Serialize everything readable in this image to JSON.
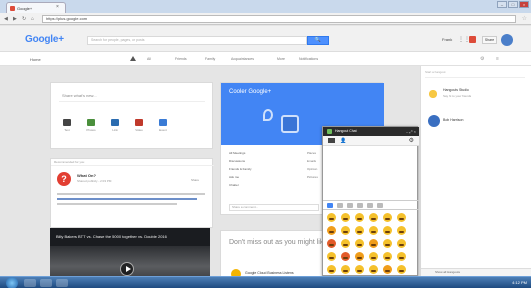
{
  "browser": {
    "tab_title": "Google+",
    "tab_close": "×",
    "url": "https://plus.google.com",
    "nav_back": "◀",
    "nav_forward": "▶",
    "nav_reload": "↻",
    "nav_home": "⌂",
    "star": "☆",
    "window_controls": [
      "–",
      "□",
      "×"
    ]
  },
  "header": {
    "logo": "Google+",
    "search_placeholder": "Search for people, pages, or posts",
    "search_button": "🔍",
    "user_name": "Frank",
    "share_label": "Share"
  },
  "subnav": {
    "home_label": "Home",
    "filters": [
      "All",
      "Friends",
      "Family",
      "Acquaintances",
      "More",
      "Notifications"
    ]
  },
  "share_box": {
    "prompt": "Share what's new...",
    "actions": [
      {
        "label": "Text",
        "color": "#444"
      },
      {
        "label": "Photos",
        "color": "#4a8f3c"
      },
      {
        "label": "Link",
        "color": "#2b6cb0"
      },
      {
        "label": "Video",
        "color": "#c0392b"
      },
      {
        "label": "Event",
        "color": "#3a7bd5"
      }
    ]
  },
  "post": {
    "header": "Recommended for you",
    "author": "What On?",
    "meta": "Shared publicly - 2:03 PM",
    "share_label": "Share",
    "avatar_letter": "?"
  },
  "video": {
    "title": "Billy Bakers BTT vs. Chase the 5000 together vs. Double 2016"
  },
  "community": {
    "title": "Cooler Google+",
    "rows": [
      {
        "left": "All Meetings",
        "right": "Places"
      },
      {
        "left": "Discussions",
        "right": "Emails"
      },
      {
        "left": "Friends & Family",
        "right": "Opinion"
      },
      {
        "left": "Ask me",
        "right": "Pictures"
      },
      {
        "left": "Chatter",
        "right": ""
      }
    ],
    "input_placeholder": "Share a comment..."
  },
  "know": {
    "title": "Don't miss out as you might like",
    "item": "Google Cloud Business Listens"
  },
  "sidebar": {
    "search_placeholder": "Start a hangout",
    "contacts": [
      {
        "name": "Hangouts Studio",
        "sub": "Say hi to your friends"
      },
      {
        "name": "Bob Harrison",
        "sub": ""
      }
    ],
    "bottom": "Show all Hangouts"
  },
  "hangout": {
    "title": "Hangout Chat",
    "controls": "– ⤢ ×",
    "gear": "⚙",
    "person": "👤"
  },
  "emoji_rows": [
    [
      "y",
      "y",
      "y",
      "y",
      "y",
      "y"
    ],
    [
      "o",
      "y",
      "y",
      "y",
      "y",
      "y"
    ],
    [
      "r",
      "y",
      "y",
      "o",
      "y",
      "y"
    ],
    [
      "y",
      "r",
      "o",
      "y",
      "y",
      "y"
    ],
    [
      "y",
      "y",
      "y",
      "y",
      "o",
      "y"
    ],
    [
      "y",
      "y",
      "y",
      "y",
      "y",
      "y"
    ]
  ],
  "taskbar": {
    "tray": "4:12 PM"
  }
}
